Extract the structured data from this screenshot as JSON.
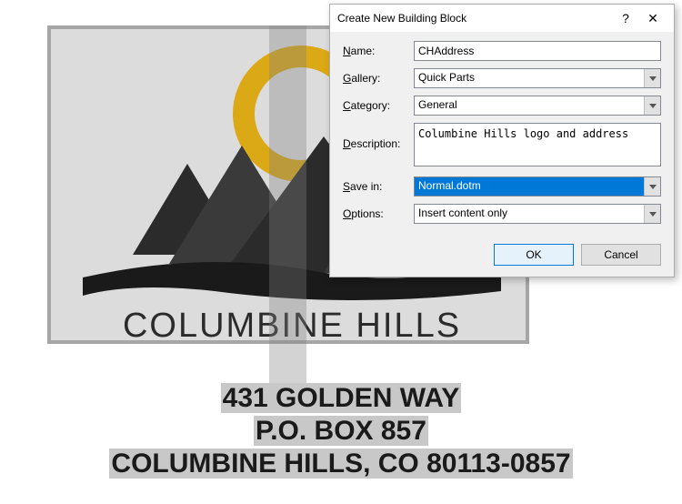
{
  "document": {
    "logo_text": "COLUMBINE HILLS",
    "address_line1": "431 GOLDEN WAY",
    "address_line2": "P.O. BOX 857",
    "address_line3": "COLUMBINE HILLS, CO  80113-0857"
  },
  "dialog": {
    "title": "Create New Building Block",
    "help": "?",
    "close": "✕",
    "labels": {
      "name": "Name:",
      "gallery": "Gallery:",
      "category": "Category:",
      "description": "Description:",
      "save_in": "Save in:",
      "options": "Options:"
    },
    "values": {
      "name": "CHAddress",
      "gallery": "Quick Parts",
      "category": "General",
      "description": "Columbine Hills logo and address",
      "save_in": "Normal.dotm",
      "options": "Insert content only"
    },
    "buttons": {
      "ok": "OK",
      "cancel": "Cancel"
    }
  }
}
